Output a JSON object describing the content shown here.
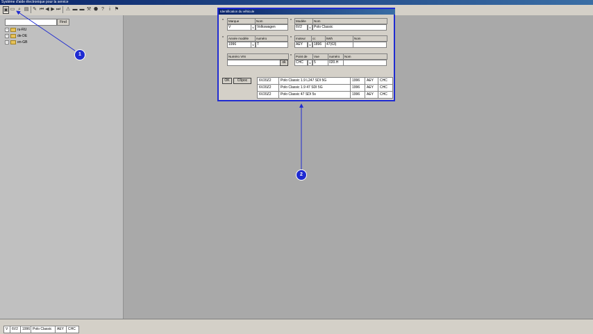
{
  "window": {
    "title": "Système d'aide électronique pour la service"
  },
  "toolbar": {
    "buttons": [
      {
        "icon": "book-icon",
        "glyph": "▣"
      },
      {
        "icon": "car-icon",
        "glyph": "▭"
      },
      {
        "icon": "search-icon",
        "glyph": "⌕"
      },
      {
        "icon": "print-icon",
        "glyph": "▤"
      },
      {
        "icon": "pencil-icon",
        "glyph": "✎"
      },
      {
        "icon": "first-page-icon",
        "glyph": "⏮"
      },
      {
        "icon": "previous-page-icon",
        "glyph": "◀"
      },
      {
        "icon": "next-page-icon",
        "glyph": "▶"
      },
      {
        "icon": "last-page-icon",
        "glyph": "⏭"
      },
      {
        "icon": "warning-icon",
        "glyph": "⚠"
      },
      {
        "icon": "car-red-icon",
        "glyph": "▬"
      },
      {
        "icon": "car-green-icon",
        "glyph": "▬"
      },
      {
        "icon": "tools-icon",
        "glyph": "⚒"
      },
      {
        "icon": "stop-icon",
        "glyph": "⬣"
      },
      {
        "icon": "help-icon",
        "glyph": "?"
      },
      {
        "icon": "info-icon",
        "glyph": "i"
      },
      {
        "icon": "flag-icon",
        "glyph": "⚑"
      }
    ]
  },
  "search": {
    "value": "",
    "find_label": "Find"
  },
  "tree": [
    {
      "label": "ru-RU"
    },
    {
      "label": "de-DE"
    },
    {
      "label": "en-GB"
    }
  ],
  "dialog": {
    "title": "Identification du véhicule",
    "marque": {
      "header_code": "Marque",
      "header_name": "Nom",
      "code": "V",
      "name": "Volkswagen"
    },
    "modele": {
      "header_code": "Modèle",
      "header_name": "Nom",
      "code": "6V2",
      "name": "Polo Classic"
    },
    "annee": {
      "header_year": "Année modèle",
      "header_num": "numéro",
      "year": "1996",
      "num": "T"
    },
    "moteur": {
      "header_code": "moteur",
      "header_cc": "cc",
      "header_kw": "kWh",
      "header_name": "Nom",
      "code": "AEY",
      "cc": "1896",
      "kw": "47(63)",
      "name": ""
    },
    "vin": {
      "header": "Numéro VIN",
      "value": "",
      "ok_label": "ok"
    },
    "point": {
      "header_code": "Point de",
      "header_vue": "Vue",
      "header_num": "numéro",
      "header_name": "Nom",
      "code": "CHC",
      "vue": "5",
      "num": "020.H",
      "name": ""
    },
    "ok_label": "OK",
    "reset_label": "Сброс",
    "results": [
      {
        "code": "6V20Z2",
        "name": "Polo Classic 1.9 L247 SDI 5G",
        "year": "1996",
        "engine": "AEY",
        "point": "CHC"
      },
      {
        "code": "6V20Z2",
        "name": "Polo Classic 1.9 47 SDI 5G",
        "year": "1996",
        "engine": "AEY",
        "point": "CHC"
      },
      {
        "code": "6V20Z2",
        "name": "Polo Classic 47 SDI 5s",
        "year": "1996",
        "engine": "AEY",
        "point": "CHC"
      }
    ]
  },
  "status": {
    "items": [
      "V",
      "6V2",
      "1996",
      "Polo Classic",
      "AEY",
      "CHC"
    ]
  },
  "markers": {
    "m1": "1",
    "m2": "2"
  },
  "colors": {
    "annotation": "#1f2bd1",
    "titlebar": "#0a246a"
  }
}
